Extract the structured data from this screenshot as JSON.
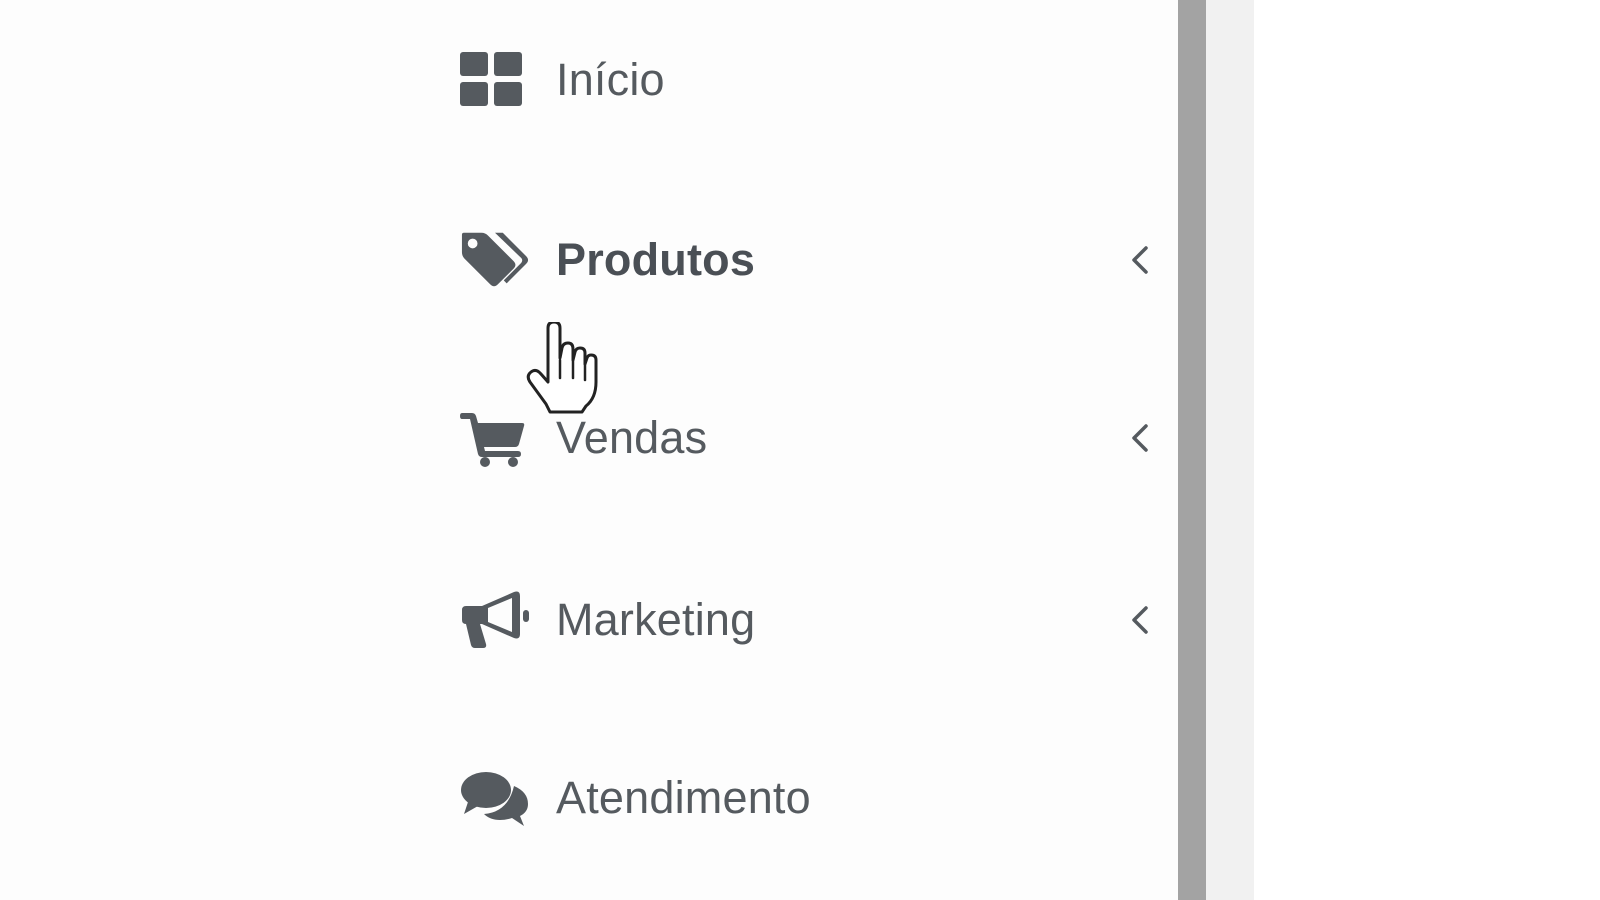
{
  "sidebar": {
    "items": [
      {
        "label": "Início",
        "icon": "dashboard-icon",
        "has_submenu": false,
        "active": false
      },
      {
        "label": "Produtos",
        "icon": "tags-icon",
        "has_submenu": true,
        "active": true
      },
      {
        "label": "Vendas",
        "icon": "shopping-cart-icon",
        "has_submenu": true,
        "active": false
      },
      {
        "label": "Marketing",
        "icon": "megaphone-icon",
        "has_submenu": true,
        "active": false
      },
      {
        "label": "Atendimento",
        "icon": "chat-bubbles-icon",
        "has_submenu": false,
        "active": false
      }
    ]
  },
  "colors": {
    "icon": "#555a5f",
    "text": "#555a5f",
    "scrollbar": "#a3a3a3",
    "background": "#fdfdfd"
  },
  "cursor": {
    "icon": "hand-pointer-icon"
  }
}
